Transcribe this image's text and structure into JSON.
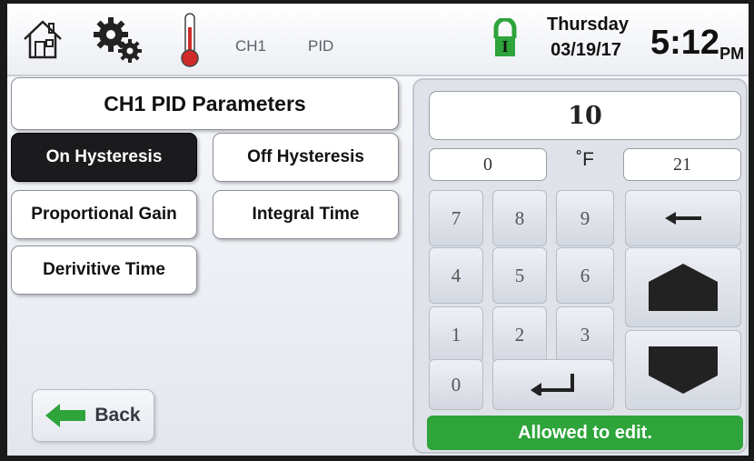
{
  "header": {
    "breadcrumb": [
      "CH1",
      "PID"
    ],
    "day": "Thursday",
    "date": "03/19/17",
    "time": "5:12",
    "ampm": "PM",
    "lock_badge": "I",
    "icons": [
      "home-icon",
      "gear-icon",
      "thermometer-icon",
      "lock-icon"
    ]
  },
  "page": {
    "title": "CH1 PID Parameters"
  },
  "params": {
    "on_hysteresis": "On Hysteresis",
    "off_hysteresis": "Off Hysteresis",
    "proportional_gain": "Proportional Gain",
    "integral_time": "Integral Time",
    "derivative_time": "Derivitive Time",
    "selected": "On Hysteresis"
  },
  "back": {
    "label": "Back"
  },
  "keypad": {
    "value": "10",
    "min": "0",
    "unit": "˚F",
    "max": "21",
    "digits": {
      "7": "7",
      "8": "8",
      "9": "9",
      "4": "4",
      "5": "5",
      "6": "6",
      "1": "1",
      "2": "2",
      "3": "3",
      "0": "0"
    },
    "icons": [
      "backspace-icon",
      "enter-icon",
      "up-arrow-icon",
      "down-arrow-icon"
    ]
  },
  "status": {
    "message": "Allowed to edit.",
    "color": "#2ea43a"
  },
  "colors": {
    "active_button": "#1b1b1d",
    "thermo_red": "#d02a2a",
    "lock_green": "#2ea43a"
  }
}
